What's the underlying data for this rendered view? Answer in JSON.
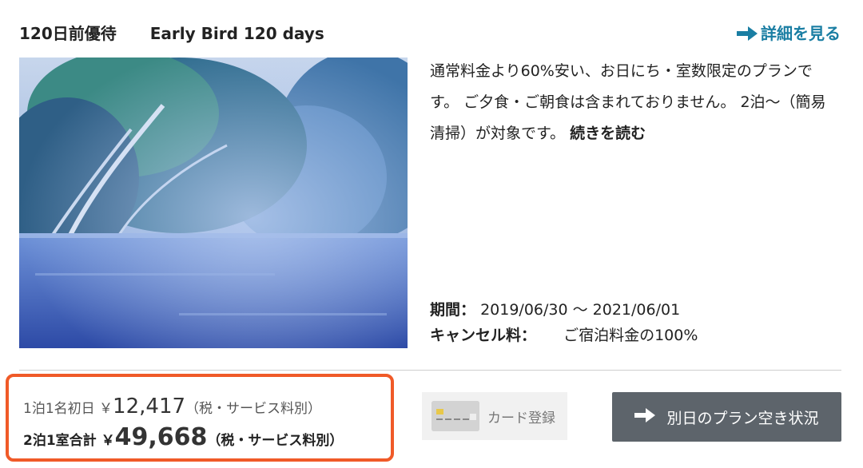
{
  "plan": {
    "title_ja": "120日前優待",
    "title_en": "Early Bird 120 days",
    "details_link": "詳細を見る",
    "description": "通常料金より60%安い、お日にち・室数限定のプランです。 ご夕食・ご朝食は含まれておりません。 2泊〜（簡易清掃）が対象です。",
    "read_more": "続きを読む",
    "period_label": "期間：",
    "period_value": "2019/06/30 〜 2021/06/01",
    "cancel_label": "キャンセル料：",
    "cancel_value": "ご宿泊料金の100%"
  },
  "price": {
    "line1_label": "1泊1名初日 ￥",
    "line1_amount": "12,417",
    "line1_note": "（税・サービス料別）",
    "line2_label": "2泊1室合計 ￥",
    "line2_amount": "49,668",
    "line2_note": "（税・サービス料別）"
  },
  "buttons": {
    "card_register": "カード登録",
    "other_dates": "別日のプラン空き状況"
  },
  "colors": {
    "link": "#1a7ea3",
    "highlight_border": "#f05a28",
    "button_bg": "#5d646b"
  }
}
